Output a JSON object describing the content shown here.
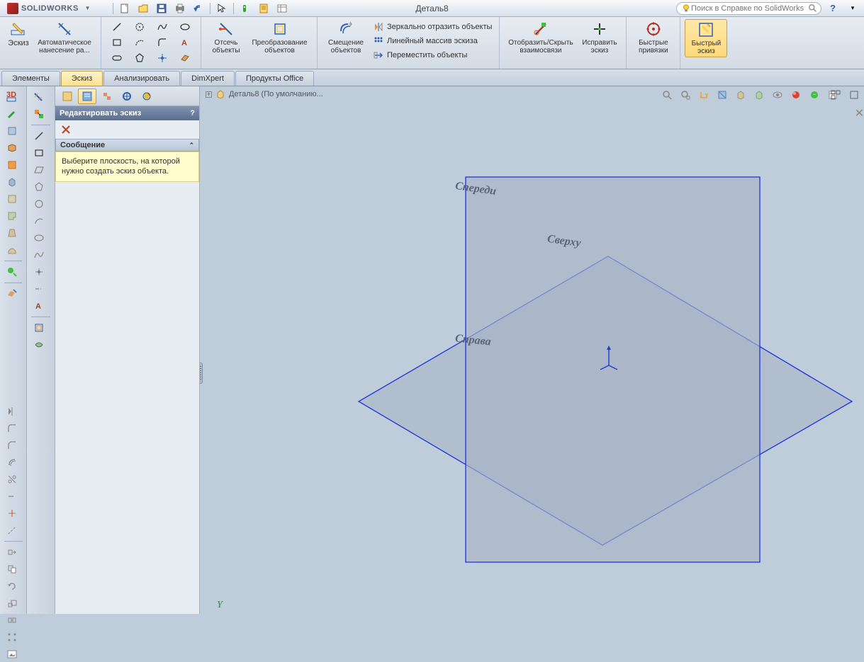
{
  "app": {
    "name": "SOLIDWORKS",
    "doc_title": "Деталь8"
  },
  "search": {
    "placeholder": "Поиск в Справке по SolidWorks"
  },
  "ribbon": {
    "sketch_btn": "Эскиз",
    "auto_dim_btn": "Автоматическое нанесение ра...",
    "trim_btn": "Отсечь объекты",
    "convert_btn": "Преобразование объектов",
    "offset_btn": "Смещение объектов",
    "mirror": "Зеркально отразить объекты",
    "pattern": "Линейный массив эскиза",
    "move": "Переместить объекты",
    "display_hide": "Отобразить/Скрыть взаимосвязи",
    "fix_sketch": "Исправить эскиз",
    "quick_snaps": "Быстрые привязки",
    "quick_sketch": "Быстрый эскиз"
  },
  "tabs": {
    "features": "Элементы",
    "sketch": "Эскиз",
    "analyze": "Анализировать",
    "dimxpert": "DimXpert",
    "office": "Продукты Office"
  },
  "panel": {
    "title": "Редактировать эскиз",
    "help": "?",
    "msg_header": "Сообщение",
    "msg_body": "Выберите плоскость, на которой нужно создать эскиз объекта."
  },
  "viewport": {
    "breadcrumb": "Деталь8  (По умолчанию...",
    "plane_front": "Спереди",
    "plane_top": "Сверху",
    "plane_right": "Справа",
    "axis_y": "Y"
  }
}
